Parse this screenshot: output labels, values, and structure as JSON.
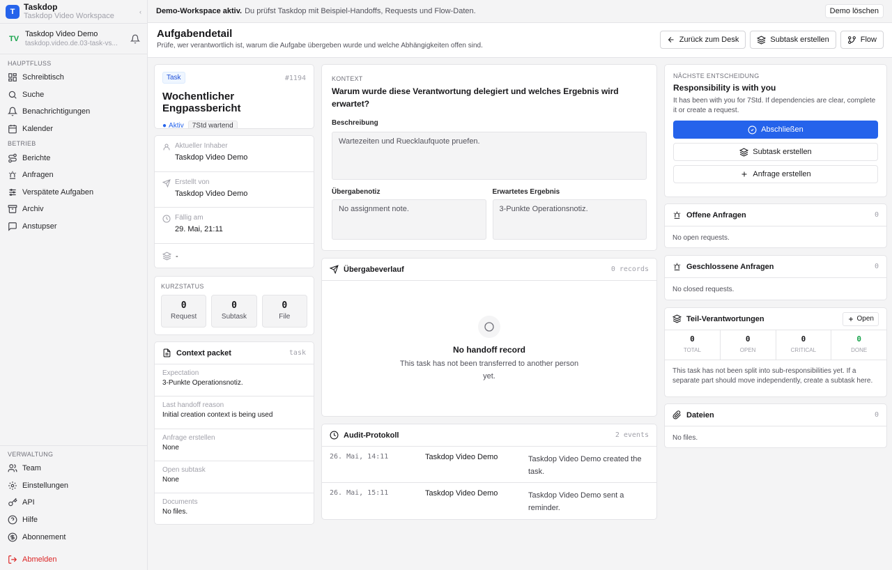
{
  "workspace": {
    "initial": "T",
    "name": "Taskdop",
    "subtitle": "Taskdop Video Workspace"
  },
  "user": {
    "initials": "TV",
    "name": "Taskdop Video Demo",
    "email": "taskdop.video.de.03-task-vs..."
  },
  "sidebar": {
    "sections": [
      {
        "label": "HAUPTFLUSS",
        "items": [
          {
            "label": "Schreibtisch",
            "icon": "layout-icon"
          },
          {
            "label": "Suche",
            "icon": "search-icon"
          },
          {
            "label": "Benachrichtigungen",
            "icon": "bell-icon"
          },
          {
            "label": "Kalender",
            "icon": "calendar-icon"
          }
        ]
      },
      {
        "label": "BETRIEB",
        "items": [
          {
            "label": "Berichte",
            "icon": "route-icon"
          },
          {
            "label": "Anfragen",
            "icon": "siren-icon"
          },
          {
            "label": "Verspätete Aufgaben",
            "icon": "sliders-icon"
          },
          {
            "label": "Archiv",
            "icon": "archive-icon"
          },
          {
            "label": "Anstupser",
            "icon": "message-icon"
          }
        ]
      }
    ],
    "admin": {
      "label": "VERWALTUNG",
      "items": [
        {
          "label": "Team",
          "icon": "users-icon"
        },
        {
          "label": "Einstellungen",
          "icon": "gear-icon"
        },
        {
          "label": "API",
          "icon": "key-icon"
        },
        {
          "label": "Hilfe",
          "icon": "help-icon"
        },
        {
          "label": "Abonnement",
          "icon": "dollar-icon"
        }
      ]
    },
    "logout": "Abmelden"
  },
  "banner": {
    "strong": "Demo-Workspace aktiv.",
    "text": "Du prüfst Taskdop mit Beispiel-Handoffs, Requests und Flow-Daten.",
    "button": "Demo löschen"
  },
  "header": {
    "title": "Aufgabendetail",
    "subtitle": "Prüfe, wer verantwortlich ist, warum die Aufgabe übergeben wurde und welche Abhängigkeiten offen sind.",
    "buttons": {
      "back": "Zurück zum Desk",
      "subtask": "Subtask erstellen",
      "flow": "Flow"
    }
  },
  "task": {
    "badge": "Task",
    "id": "#1194",
    "title": "Wochentlicher Engpassbericht",
    "status": "Aktiv",
    "waiting": "7Std wartend"
  },
  "meta": {
    "owner_label": "Aktueller Inhaber",
    "owner": "Taskdop Video Demo",
    "creator_label": "Erstellt von",
    "creator": "Taskdop Video Demo",
    "due_label": "Fällig am",
    "due": "29. Mai, 21:11",
    "stack_value": "-"
  },
  "quick_status": {
    "label": "KURZSTATUS",
    "items": [
      {
        "value": "0",
        "label": "Request"
      },
      {
        "value": "0",
        "label": "Subtask"
      },
      {
        "value": "0",
        "label": "File"
      }
    ]
  },
  "context_packet": {
    "title": "Context packet",
    "tag": "task",
    "rows": [
      {
        "label": "Expectation",
        "value": "3-Punkte Operationsnotiz."
      },
      {
        "label": "Last handoff reason",
        "value": "Initial creation context is being used"
      },
      {
        "label": "Anfrage erstellen",
        "value": "None"
      },
      {
        "label": "Open subtask",
        "value": "None"
      },
      {
        "label": "Documents",
        "value": "No files."
      }
    ]
  },
  "context": {
    "label": "KONTEXT",
    "question": "Warum wurde diese Verantwortung delegiert und welches Ergebnis wird erwartet?",
    "description_label": "Beschreibung",
    "description": "Wartezeiten und Ruecklaufquote pruefen.",
    "handoff_label": "Übergabenotiz",
    "handoff": "No assignment note.",
    "expected_label": "Erwartetes Ergebnis",
    "expected": "3-Punkte Operationsnotiz."
  },
  "handoff_history": {
    "title": "Übergabeverlauf",
    "count": "0 records",
    "empty_title": "No handoff record",
    "empty_text": "This task has not been transferred to another person yet."
  },
  "audit": {
    "title": "Audit-Protokoll",
    "count": "2 events",
    "rows": [
      {
        "time": "26. Mai, 14:11",
        "actor": "Taskdop Video Demo",
        "text": "Taskdop Video Demo created the task."
      },
      {
        "time": "26. Mai, 15:11",
        "actor": "Taskdop Video Demo",
        "text": "Taskdop Video Demo sent a reminder."
      }
    ]
  },
  "decision": {
    "label": "NÄCHSTE ENTSCHEIDUNG",
    "title": "Responsibility is with you",
    "text": "It has been with you for 7Std. If dependencies are clear, complete it or create a request.",
    "primary": "Abschließen",
    "subtask": "Subtask erstellen",
    "request": "Anfrage erstellen"
  },
  "open_requests": {
    "title": "Offene Anfragen",
    "count": "0",
    "text": "No open requests."
  },
  "closed_requests": {
    "title": "Geschlossene Anfragen",
    "count": "0",
    "text": "No closed requests."
  },
  "sub_responsibilities": {
    "title": "Teil-Verantwortungen",
    "button": "Open",
    "stats": [
      {
        "value": "0",
        "label": "TOTAL"
      },
      {
        "value": "0",
        "label": "OPEN"
      },
      {
        "value": "0",
        "label": "CRITICAL"
      },
      {
        "value": "0",
        "label": "DONE"
      }
    ],
    "text": "This task has not been split into sub-responsibilities yet. If a separate part should move independently, create a subtask here."
  },
  "files": {
    "title": "Dateien",
    "count": "0",
    "text": "No files."
  },
  "colors": {
    "accent": "#2563eb",
    "done": "#16a34a",
    "danger": "#dc2626"
  }
}
